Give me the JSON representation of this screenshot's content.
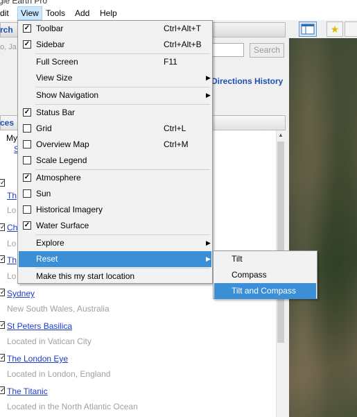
{
  "window": {
    "title": "gle Earth Pro"
  },
  "menubar": {
    "items": [
      "dit",
      "View",
      "Tools",
      "Add",
      "Help"
    ]
  },
  "left_panel": {
    "search_tab_label": "rch",
    "search_hint": "o, Ja",
    "search_button": "Search",
    "directions_link": "Directions",
    "history_link": "History",
    "places_tab_label": "ces",
    "places": [
      {
        "title": "Sydney",
        "subtitle": "New South Wales, Australia"
      },
      {
        "title": "St Peters Basilica",
        "subtitle": "Located in Vatican City"
      },
      {
        "title": "The London Eye",
        "subtitle": "Located in London, England"
      },
      {
        "title": "The Titanic",
        "subtitle": "Located in the North Atlantic Ocean"
      }
    ],
    "partial_rows": [
      {
        "title": "My"
      },
      {
        "title": "S"
      },
      {
        "title": "Th",
        "subtitle": "Lo"
      },
      {
        "title": "Ch",
        "subtitle": "Lo"
      },
      {
        "title": "Th",
        "subtitle": "Lo"
      }
    ]
  },
  "view_menu": {
    "items": [
      {
        "label": "Toolbar",
        "shortcut": "Ctrl+Alt+T",
        "checked": true
      },
      {
        "label": "Sidebar",
        "shortcut": "Ctrl+Alt+B",
        "checked": true
      },
      {
        "label": "Full Screen",
        "shortcut": "F11"
      },
      {
        "label": "View Size",
        "submenu": true
      },
      {
        "label": "Show Navigation",
        "submenu": true
      },
      {
        "label": "Status Bar",
        "checked": true
      },
      {
        "label": "Grid",
        "shortcut": "Ctrl+L",
        "checked": false
      },
      {
        "label": "Overview Map",
        "shortcut": "Ctrl+M",
        "checked": false
      },
      {
        "label": "Scale Legend",
        "checked": false
      },
      {
        "label": "Atmosphere",
        "checked": true
      },
      {
        "label": "Sun",
        "checked": false
      },
      {
        "label": "Historical Imagery",
        "checked": false
      },
      {
        "label": "Water Surface",
        "checked": true
      },
      {
        "label": "Explore",
        "submenu": true
      },
      {
        "label": "Reset",
        "submenu": true,
        "highlighted": true
      },
      {
        "label": "Make this my start location"
      }
    ]
  },
  "reset_submenu": {
    "items": [
      {
        "label": "Tilt"
      },
      {
        "label": "Compass"
      },
      {
        "label": "Tilt and Compass",
        "highlighted": true
      }
    ]
  },
  "colors": {
    "highlight": "#3a8fd6",
    "link": "#1a3cc8"
  }
}
